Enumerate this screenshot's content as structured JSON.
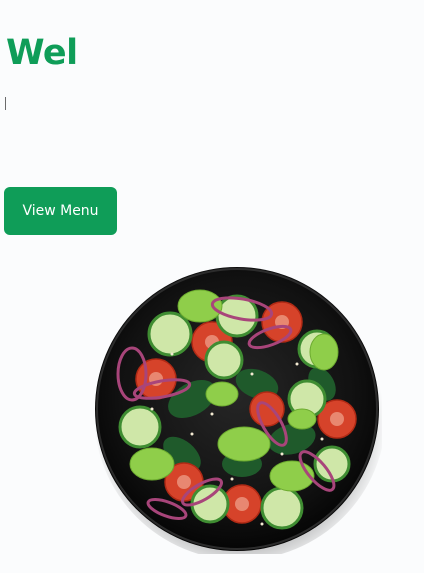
{
  "hero": {
    "title": "Wel",
    "cta_label": "View Menu"
  },
  "image": {
    "subject": "salad-bowl",
    "colors": {
      "plate": "#141414",
      "tomato": "#d6432a",
      "cucumber": "#cfe7a8",
      "lettuce": "#8fce4a",
      "spinach": "#1f5a2b",
      "onion": "#a8457a"
    }
  },
  "theme": {
    "accent": "#0f9d58",
    "background": "#fbfcfd"
  }
}
